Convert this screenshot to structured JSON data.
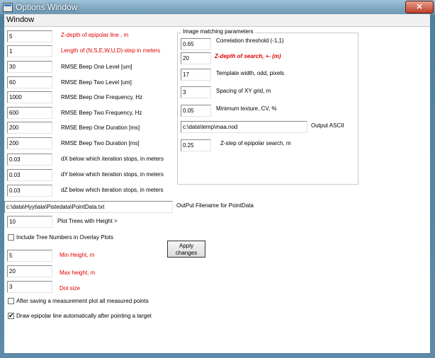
{
  "window": {
    "title": "Options Window",
    "close_glyph": "✕",
    "menu": "Window"
  },
  "left_fields": [
    {
      "value": "5",
      "label": "Z-depth of epipolar line , m",
      "style": "red"
    },
    {
      "value": "1",
      "label": "Length of (N,S,E,W,U,D)-step in meters",
      "style": "red"
    },
    {
      "value": "30",
      "label": "RMSE Beep One Level [um]",
      "style": "normal"
    },
    {
      "value": "60",
      "label": "RMSE Beep Two Level [um]",
      "style": "normal"
    },
    {
      "value": "1000",
      "label": "RMSE Beep One Frequency, Hz",
      "style": "normal"
    },
    {
      "value": "600",
      "label": "RMSE Beep Two Frequency, Hz",
      "style": "normal"
    },
    {
      "value": "200",
      "label": "RMSE Beep One Duration [ms]",
      "style": "normal"
    },
    {
      "value": "200",
      "label": "RMSE Beep Two Duration [ms]",
      "style": "normal"
    },
    {
      "value": "0.03",
      "label": "dX below which iteration stops, in meters",
      "style": "normal"
    },
    {
      "value": "0.03",
      "label": "dY below which iteration stops, in meters",
      "style": "normal"
    },
    {
      "value": "0.03",
      "label": "dZ below which iteration stops, in meters",
      "style": "normal"
    }
  ],
  "image_matching": {
    "title": "Image matching parameters",
    "fields": [
      {
        "value": "0.65",
        "label": "Correlation threshold (-1,1)",
        "style": "normal"
      },
      {
        "value": "20",
        "label": "Z-depth of search, +- (m)",
        "style": "redbold"
      },
      {
        "value": "17",
        "label": "Template width, odd, pixels",
        "style": "normal"
      },
      {
        "value": "3",
        "label": "Spacing of XY grid, m",
        "style": "normal"
      },
      {
        "value": "0.05",
        "label": "Minimum texture, CV, %",
        "style": "normal"
      }
    ],
    "output_path": "c:\\data\\temp\\maa.nod",
    "output_label": "Output ASCII",
    "zstep_value": "0.25",
    "zstep_label": "Z-step of epipolar search, m"
  },
  "point_data": {
    "path": "c:\\data\\Hyytiala\\Pistedata\\PointData.txt",
    "label": "OutPut Filename for PointData"
  },
  "plot_trees": {
    "value": "10",
    "label": "Plot Trees with Height >"
  },
  "include_tree_numbers": {
    "label": "Include Tree Numbers in Overlay Plots",
    "checked": false
  },
  "apply_button": {
    "line1": "Apply",
    "line2": "changes"
  },
  "red_fields": [
    {
      "value": "5",
      "label": "Min Height, m"
    },
    {
      "value": "20",
      "label": "Max height, m"
    },
    {
      "value": "3",
      "label": "Dot size"
    }
  ],
  "after_saving": {
    "label": "After saving a measurement plot all measured points",
    "checked": false
  },
  "draw_epipolar": {
    "label": "Draw epipolar line automatically after pointing a target",
    "checked": true
  },
  "check_glyph": "✔"
}
